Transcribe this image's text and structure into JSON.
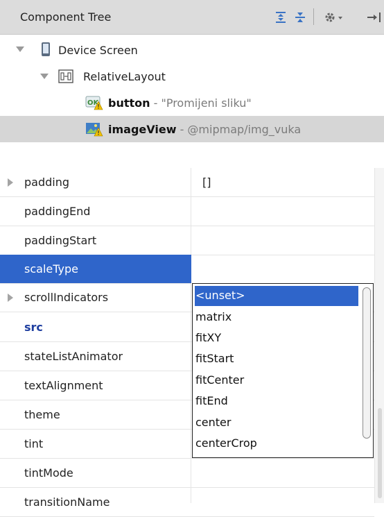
{
  "tree_panel": {
    "title": "Component Tree",
    "toolbar": [
      "expand-all-icon",
      "collapse-all-icon",
      "gear-icon",
      "hide-panel-icon"
    ],
    "nodes": [
      {
        "label": "Device Screen",
        "icon": "device-icon",
        "expanded": true
      },
      {
        "label": "RelativeLayout",
        "icon": "relative-layout-icon",
        "expanded": true
      },
      {
        "id": "button",
        "detail": " - \"Promijeni sliku\"",
        "icon": "button-warning-icon"
      },
      {
        "id": "imageView",
        "detail": " - @mipmap/img_vuka",
        "icon": "image-warning-icon",
        "selected": true
      }
    ]
  },
  "properties": {
    "rows": [
      {
        "name": "padding",
        "value": "[]",
        "expandable": true
      },
      {
        "name": "paddingEnd",
        "value": ""
      },
      {
        "name": "paddingStart",
        "value": ""
      },
      {
        "name": "scaleType",
        "value": "",
        "selected": true
      },
      {
        "name": "scrollIndicators",
        "value": "",
        "expandable": true
      },
      {
        "name": "src",
        "value": "",
        "bold": true
      },
      {
        "name": "stateListAnimator",
        "value": ""
      },
      {
        "name": "textAlignment",
        "value": ""
      },
      {
        "name": "theme",
        "value": ""
      },
      {
        "name": "tint",
        "value": ""
      },
      {
        "name": "tintMode",
        "value": ""
      },
      {
        "name": "transitionName",
        "value": ""
      }
    ]
  },
  "scale_type_dropdown": {
    "options": [
      "<unset>",
      "matrix",
      "fitXY",
      "fitStart",
      "fitCenter",
      "fitEnd",
      "center",
      "centerCrop"
    ],
    "selected": "<unset>"
  },
  "colors": {
    "selection": "#2f65ca",
    "tree_selection": "#d6d6d6",
    "header_bg": "#dcdcdc",
    "warning": "#f2c200",
    "src_label": "#1f3fa0"
  }
}
